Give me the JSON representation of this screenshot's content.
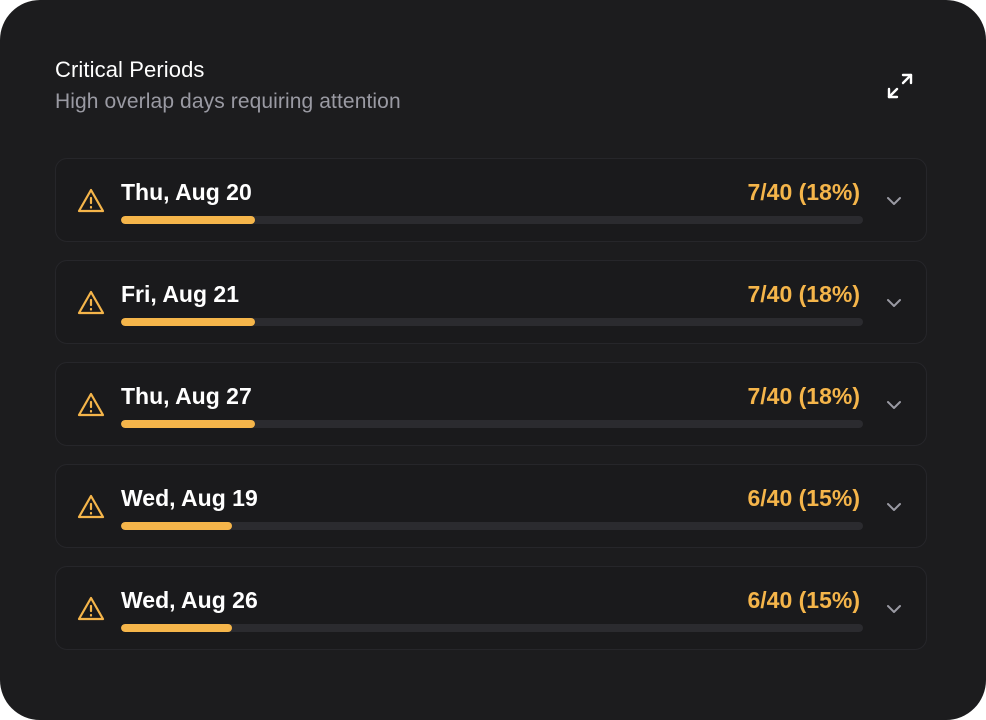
{
  "panel": {
    "title": "Critical Periods",
    "subtitle": "High overlap days requiring attention"
  },
  "icons": {
    "expand": "expand-icon",
    "warning": "warning-triangle-icon",
    "chevron": "chevron-down-icon"
  },
  "colors": {
    "accent": "#f5b54a",
    "background": "#1c1c1e",
    "track": "#2b2b2f"
  },
  "periods": [
    {
      "date": "Thu, Aug 20",
      "count_label": "7/40 (18%)",
      "fraction": 0.18
    },
    {
      "date": "Fri, Aug 21",
      "count_label": "7/40 (18%)",
      "fraction": 0.18
    },
    {
      "date": "Thu, Aug 27",
      "count_label": "7/40 (18%)",
      "fraction": 0.18
    },
    {
      "date": "Wed, Aug 19",
      "count_label": "6/40 (15%)",
      "fraction": 0.15
    },
    {
      "date": "Wed, Aug 26",
      "count_label": "6/40 (15%)",
      "fraction": 0.15
    }
  ]
}
